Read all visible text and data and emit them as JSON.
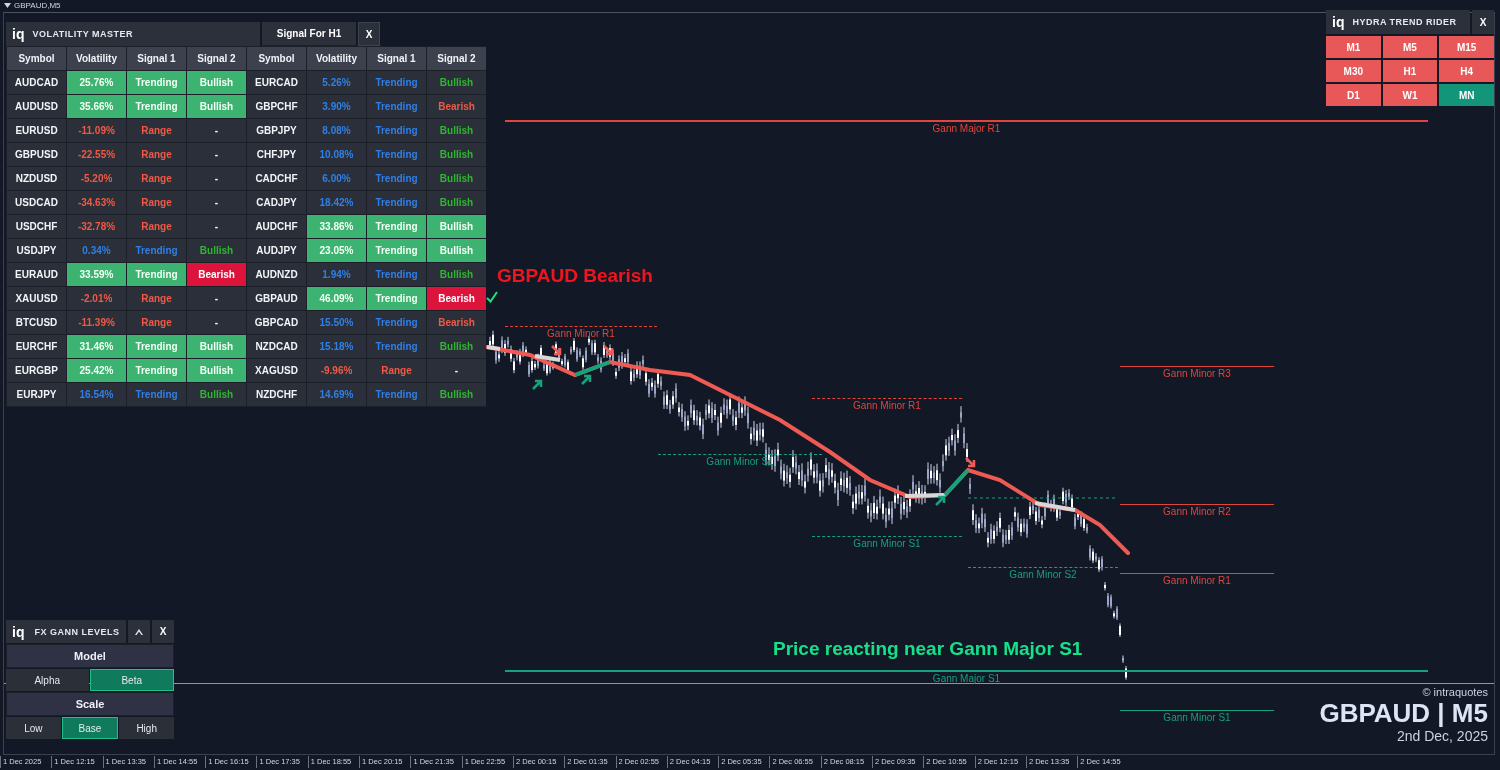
{
  "chart": {
    "title": "GBPAUD,M5"
  },
  "volatility_master": {
    "logo": "iq",
    "title": "VOLATILITY MASTER",
    "tab": "Signal For H1",
    "close": "X",
    "columns": [
      "Symbol",
      "Volatility",
      "Signal 1",
      "Signal 2",
      "Symbol",
      "Volatility",
      "Signal 1",
      "Signal 2"
    ],
    "rows": [
      {
        "cells": [
          {
            "text": "AUDCAD",
            "kind": "plain"
          },
          {
            "text": "25.76%",
            "kind": "strong"
          },
          {
            "text": "Trending",
            "kind": "strong"
          },
          {
            "text": "Bullish",
            "kind": "strong"
          },
          {
            "text": "EURCAD",
            "kind": "plain"
          },
          {
            "text": "5.26%",
            "kind": "blue"
          },
          {
            "text": "Trending",
            "kind": "blue"
          },
          {
            "text": "Bullish",
            "kind": "green"
          }
        ]
      },
      {
        "cells": [
          {
            "text": "AUDUSD",
            "kind": "plain"
          },
          {
            "text": "35.66%",
            "kind": "strong"
          },
          {
            "text": "Trending",
            "kind": "strong"
          },
          {
            "text": "Bullish",
            "kind": "strong"
          },
          {
            "text": "GBPCHF",
            "kind": "plain"
          },
          {
            "text": "3.90%",
            "kind": "blue"
          },
          {
            "text": "Trending",
            "kind": "blue"
          },
          {
            "text": "Bearish",
            "kind": "red"
          }
        ]
      },
      {
        "cells": [
          {
            "text": "EURUSD",
            "kind": "plain"
          },
          {
            "text": "-11.09%",
            "kind": "red"
          },
          {
            "text": "Range",
            "kind": "red"
          },
          {
            "text": "-",
            "kind": "plain"
          },
          {
            "text": "GBPJPY",
            "kind": "plain"
          },
          {
            "text": "8.08%",
            "kind": "blue"
          },
          {
            "text": "Trending",
            "kind": "blue"
          },
          {
            "text": "Bullish",
            "kind": "green"
          }
        ]
      },
      {
        "cells": [
          {
            "text": "GBPUSD",
            "kind": "plain"
          },
          {
            "text": "-22.55%",
            "kind": "red"
          },
          {
            "text": "Range",
            "kind": "red"
          },
          {
            "text": "-",
            "kind": "plain"
          },
          {
            "text": "CHFJPY",
            "kind": "plain"
          },
          {
            "text": "10.08%",
            "kind": "blue"
          },
          {
            "text": "Trending",
            "kind": "blue"
          },
          {
            "text": "Bullish",
            "kind": "green"
          }
        ]
      },
      {
        "cells": [
          {
            "text": "NZDUSD",
            "kind": "plain"
          },
          {
            "text": "-5.20%",
            "kind": "red"
          },
          {
            "text": "Range",
            "kind": "red"
          },
          {
            "text": "-",
            "kind": "plain"
          },
          {
            "text": "CADCHF",
            "kind": "plain"
          },
          {
            "text": "6.00%",
            "kind": "blue"
          },
          {
            "text": "Trending",
            "kind": "blue"
          },
          {
            "text": "Bullish",
            "kind": "green"
          }
        ]
      },
      {
        "cells": [
          {
            "text": "USDCAD",
            "kind": "plain"
          },
          {
            "text": "-34.63%",
            "kind": "red"
          },
          {
            "text": "Range",
            "kind": "red"
          },
          {
            "text": "-",
            "kind": "plain"
          },
          {
            "text": "CADJPY",
            "kind": "plain"
          },
          {
            "text": "18.42%",
            "kind": "blue"
          },
          {
            "text": "Trending",
            "kind": "blue"
          },
          {
            "text": "Bullish",
            "kind": "green"
          }
        ]
      },
      {
        "cells": [
          {
            "text": "USDCHF",
            "kind": "plain"
          },
          {
            "text": "-32.78%",
            "kind": "red"
          },
          {
            "text": "Range",
            "kind": "red"
          },
          {
            "text": "-",
            "kind": "plain"
          },
          {
            "text": "AUDCHF",
            "kind": "plain"
          },
          {
            "text": "33.86%",
            "kind": "strong"
          },
          {
            "text": "Trending",
            "kind": "strong"
          },
          {
            "text": "Bullish",
            "kind": "strong"
          }
        ]
      },
      {
        "cells": [
          {
            "text": "USDJPY",
            "kind": "plain"
          },
          {
            "text": "0.34%",
            "kind": "blue"
          },
          {
            "text": "Trending",
            "kind": "blue"
          },
          {
            "text": "Bullish",
            "kind": "green"
          },
          {
            "text": "AUDJPY",
            "kind": "plain"
          },
          {
            "text": "23.05%",
            "kind": "strong"
          },
          {
            "text": "Trending",
            "kind": "strong"
          },
          {
            "text": "Bullish",
            "kind": "strong"
          }
        ]
      },
      {
        "cells": [
          {
            "text": "EURAUD",
            "kind": "plain"
          },
          {
            "text": "33.59%",
            "kind": "strong"
          },
          {
            "text": "Trending",
            "kind": "strong"
          },
          {
            "text": "Bearish",
            "kind": "alert"
          },
          {
            "text": "AUDNZD",
            "kind": "plain"
          },
          {
            "text": "1.94%",
            "kind": "blue"
          },
          {
            "text": "Trending",
            "kind": "blue"
          },
          {
            "text": "Bullish",
            "kind": "green"
          }
        ]
      },
      {
        "cells": [
          {
            "text": "XAUUSD",
            "kind": "plain"
          },
          {
            "text": "-2.01%",
            "kind": "red"
          },
          {
            "text": "Range",
            "kind": "red"
          },
          {
            "text": "-",
            "kind": "plain"
          },
          {
            "text": "GBPAUD",
            "kind": "plain"
          },
          {
            "text": "46.09%",
            "kind": "strong"
          },
          {
            "text": "Trending",
            "kind": "strong"
          },
          {
            "text": "Bearish",
            "kind": "alert"
          }
        ]
      },
      {
        "cells": [
          {
            "text": "BTCUSD",
            "kind": "plain"
          },
          {
            "text": "-11.39%",
            "kind": "red"
          },
          {
            "text": "Range",
            "kind": "red"
          },
          {
            "text": "-",
            "kind": "plain"
          },
          {
            "text": "GBPCAD",
            "kind": "plain"
          },
          {
            "text": "15.50%",
            "kind": "blue"
          },
          {
            "text": "Trending",
            "kind": "blue"
          },
          {
            "text": "Bearish",
            "kind": "red"
          }
        ]
      },
      {
        "cells": [
          {
            "text": "EURCHF",
            "kind": "plain"
          },
          {
            "text": "31.46%",
            "kind": "strong"
          },
          {
            "text": "Trending",
            "kind": "strong"
          },
          {
            "text": "Bullish",
            "kind": "strong"
          },
          {
            "text": "NZDCAD",
            "kind": "plain"
          },
          {
            "text": "15.18%",
            "kind": "blue"
          },
          {
            "text": "Trending",
            "kind": "blue"
          },
          {
            "text": "Bullish",
            "kind": "green"
          }
        ]
      },
      {
        "cells": [
          {
            "text": "EURGBP",
            "kind": "plain"
          },
          {
            "text": "25.42%",
            "kind": "strong"
          },
          {
            "text": "Trending",
            "kind": "strong"
          },
          {
            "text": "Bullish",
            "kind": "strong"
          },
          {
            "text": "XAGUSD",
            "kind": "plain"
          },
          {
            "text": "-9.96%",
            "kind": "red"
          },
          {
            "text": "Range",
            "kind": "red"
          },
          {
            "text": "-",
            "kind": "plain"
          }
        ]
      },
      {
        "cells": [
          {
            "text": "EURJPY",
            "kind": "plain"
          },
          {
            "text": "16.54%",
            "kind": "blue"
          },
          {
            "text": "Trending",
            "kind": "blue"
          },
          {
            "text": "Bullish",
            "kind": "green"
          },
          {
            "text": "NZDCHF",
            "kind": "plain"
          },
          {
            "text": "14.69%",
            "kind": "blue"
          },
          {
            "text": "Trending",
            "kind": "blue"
          },
          {
            "text": "Bullish",
            "kind": "green"
          }
        ]
      }
    ]
  },
  "hydra_trend_rider": {
    "logo": "iq",
    "title": "HYDRA TREND RIDER",
    "close": "X",
    "timeframes": [
      {
        "label": "M1",
        "kind": "bearish"
      },
      {
        "label": "M5",
        "kind": "bearish"
      },
      {
        "label": "M15",
        "kind": "bearish"
      },
      {
        "label": "M30",
        "kind": "bearish"
      },
      {
        "label": "H1",
        "kind": "bearish"
      },
      {
        "label": "H4",
        "kind": "bearish"
      },
      {
        "label": "D1",
        "kind": "bearish"
      },
      {
        "label": "W1",
        "kind": "bearish"
      },
      {
        "label": "MN",
        "kind": "bullish"
      }
    ]
  },
  "gann_levels_panel": {
    "logo": "iq",
    "title": "FX GANN LEVELS",
    "close": "X",
    "sections": [
      {
        "title": "Model",
        "options": [
          {
            "label": "Alpha",
            "selected": false
          },
          {
            "label": "Beta",
            "selected": true
          }
        ]
      },
      {
        "title": "Scale",
        "options": [
          {
            "label": "Low",
            "selected": false
          },
          {
            "label": "Base",
            "selected": true
          },
          {
            "label": "High",
            "selected": false
          }
        ]
      }
    ]
  },
  "levels": [
    {
      "label": "Gann Major R1",
      "color": "#e0453c",
      "kind": "major"
    },
    {
      "label": "Gann Minor R1",
      "color": "#e0453c",
      "kind": "dashed"
    },
    {
      "label": "Gann Minor S1",
      "color": "#16a07b",
      "kind": "dashed"
    },
    {
      "label": "Gann Minor R1",
      "color": "#e0453c",
      "kind": "dashed"
    },
    {
      "label": "Gann Minor S1",
      "color": "#16a07b",
      "kind": "dashed"
    },
    {
      "label": "Gann Minor S2",
      "color": "#16a07b",
      "kind": "dashed"
    },
    {
      "label": "Gann Minor R3",
      "color": "#e0453c",
      "kind": "solid"
    },
    {
      "label": "Gann Minor R2",
      "color": "#e0453c",
      "kind": "solid"
    },
    {
      "label": "Gann Minor R1",
      "color": "#e0453c",
      "kind": "solid"
    },
    {
      "label": "Gann Major S1",
      "color": "#16a07b",
      "kind": "major"
    },
    {
      "label": "Gann Minor S1",
      "color": "#16a07b",
      "kind": "solid"
    }
  ],
  "annotations": [
    {
      "text": "GBPAUD Bearish",
      "kind": "bearish"
    },
    {
      "text": "Price reacting near Gann Major S1",
      "kind": "bullish"
    }
  ],
  "branding": {
    "copyright": "© intraquotes",
    "symbol": "GBPAUD | M5",
    "date": "2nd Dec, 2025"
  },
  "time_axis": [
    "1 Dec 2025",
    "1 Dec 12:15",
    "1 Dec 13:35",
    "1 Dec 14:55",
    "1 Dec 16:15",
    "1 Dec 17:35",
    "1 Dec 18:55",
    "1 Dec 20:15",
    "1 Dec 21:35",
    "1 Dec 22:55",
    "2 Dec 00:15",
    "2 Dec 01:35",
    "2 Dec 02:55",
    "2 Dec 04:15",
    "2 Dec 05:35",
    "2 Dec 06:55",
    "2 Dec 08:15",
    "2 Dec 09:35",
    "2 Dec 10:55",
    "2 Dec 12:15",
    "2 Dec 13:35",
    "2 Dec 14:55"
  ]
}
